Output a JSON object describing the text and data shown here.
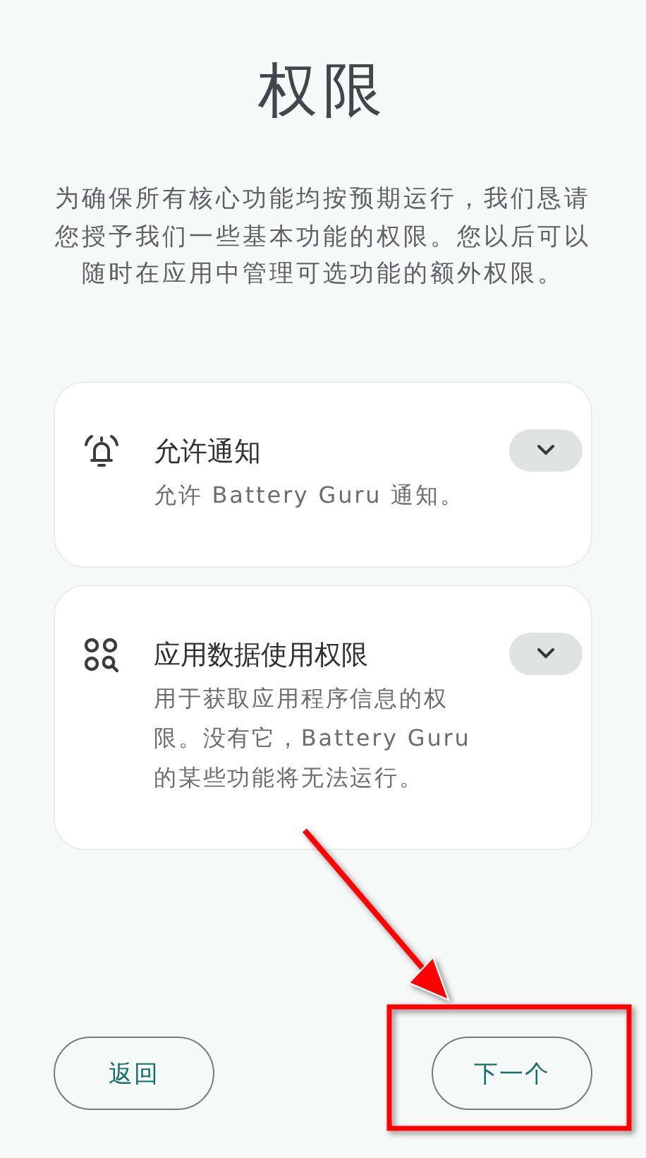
{
  "title": "权限",
  "description": "为确保所有核心功能均按预期运行，我们恳请您授予我们一些基本功能的权限。您以后可以随时在应用中管理可选功能的额外权限。",
  "permissions": [
    {
      "kind": "bell",
      "title": "允许通知",
      "subtitle": "允许 Battery Guru 通知。",
      "expanded": false
    },
    {
      "kind": "apps",
      "title": "应用数据使用权限",
      "subtitle": "用于获取应用程序信息的权限。没有它，Battery Guru 的某些功能将无法运行。",
      "expanded": false
    }
  ],
  "buttons": [
    {
      "kind": "back",
      "label": "返回"
    },
    {
      "kind": "next",
      "label": "下一个"
    }
  ],
  "annotations": [
    {
      "kind": "arrow"
    },
    {
      "kind": "highlight"
    }
  ]
}
